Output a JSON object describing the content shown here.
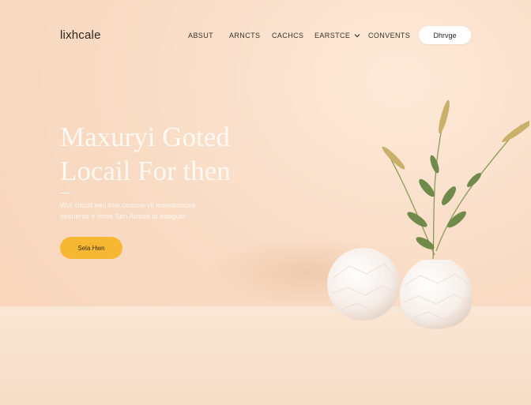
{
  "brand": {
    "logo_text": "lixhcale"
  },
  "nav": {
    "items": [
      {
        "label": "ABSUT"
      },
      {
        "label": "ARNCTS"
      },
      {
        "label": "CACHCS"
      },
      {
        "label": "EARSTCE",
        "has_dropdown": true
      },
      {
        "label": "CONVENTS"
      }
    ],
    "cta_label": "Dhrvge"
  },
  "hero": {
    "title_line1": "Maxuryi Goted",
    "title_line2": "Locail For then",
    "subtitle": "Wol ciicud eeu lrne ceucne yll ieqvutioncee\nseeuerse e hnoe Sen Amrea ia eaegutn",
    "button_label": "Sela Hwn"
  },
  "colors": {
    "background": "#f8dcc6",
    "accent_button": "#f6b732",
    "text_dark": "#2c2520",
    "hero_text": "#fff9f3"
  },
  "icons": {
    "dropdown": "chevron-down-icon"
  }
}
